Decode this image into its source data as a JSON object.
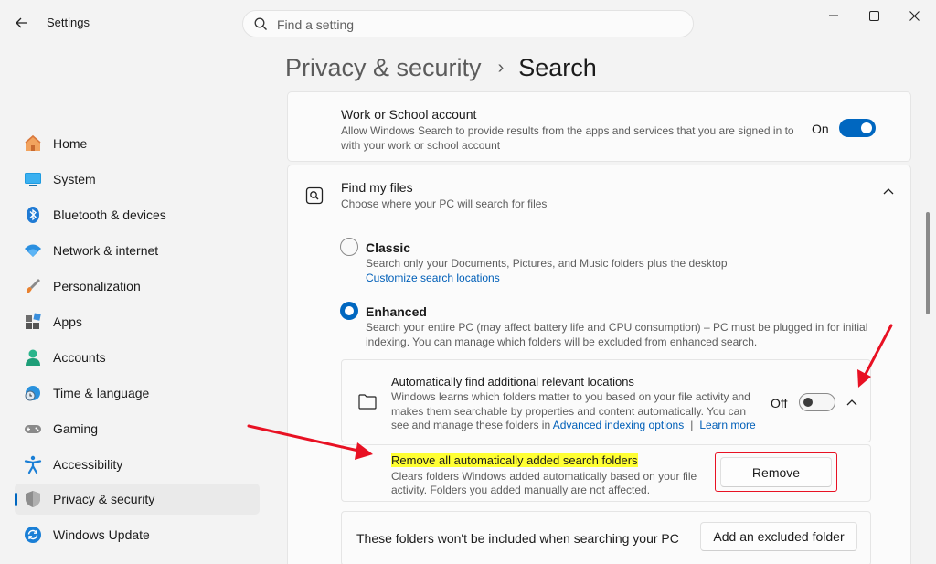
{
  "window": {
    "title": "Settings",
    "search_placeholder": "Find a setting"
  },
  "sidebar": {
    "items": [
      {
        "label": "Home",
        "icon": "home-icon"
      },
      {
        "label": "System",
        "icon": "system-icon"
      },
      {
        "label": "Bluetooth & devices",
        "icon": "bluetooth-icon"
      },
      {
        "label": "Network & internet",
        "icon": "wifi-icon"
      },
      {
        "label": "Personalization",
        "icon": "brush-icon"
      },
      {
        "label": "Apps",
        "icon": "apps-icon"
      },
      {
        "label": "Accounts",
        "icon": "accounts-icon"
      },
      {
        "label": "Time & language",
        "icon": "globe-clock-icon"
      },
      {
        "label": "Gaming",
        "icon": "gamepad-icon"
      },
      {
        "label": "Accessibility",
        "icon": "accessibility-icon"
      },
      {
        "label": "Privacy & security",
        "icon": "shield-icon",
        "selected": true
      },
      {
        "label": "Windows Update",
        "icon": "update-icon"
      }
    ]
  },
  "breadcrumb": {
    "parent": "Privacy & security",
    "separator": "›",
    "current": "Search"
  },
  "work_account": {
    "title": "Work or School account",
    "description_line1": "Allow Windows Search to provide results from the apps and services that you are signed in to",
    "description_line2": "with your work or school account",
    "toggle_label": "On",
    "toggle_on": true
  },
  "find_files": {
    "title": "Find my files",
    "description": "Choose where your PC will search for files",
    "expanded": true,
    "classic": {
      "label": "Classic",
      "description": "Search only your Documents, Pictures, and Music folders plus the desktop",
      "link": "Customize search locations",
      "selected": false
    },
    "enhanced": {
      "label": "Enhanced",
      "description_line1": "Search your entire PC (may affect battery life and CPU consumption) – PC must be plugged in for initial",
      "description_line2": "indexing. You can manage which folders will be excluded from enhanced search.",
      "selected": true
    }
  },
  "auto_locations": {
    "title": "Automatically find additional relevant locations",
    "description_line1": "Windows learns which folders matter to you based on your file activity and",
    "description_line2": "makes them searchable by properties and content automatically. You can",
    "description_line3_prefix": "see and manage these folders in ",
    "link_advanced": "Advanced indexing options",
    "link_separator": "|",
    "link_learn": "Learn more",
    "toggle_label": "Off",
    "toggle_on": false
  },
  "remove_folders": {
    "title": "Remove all automatically added search folders",
    "description_line1": "Clears folders Windows added automatically based on your file",
    "description_line2": "activity. Folders you added manually are not affected.",
    "button_label": "Remove"
  },
  "excluded": {
    "text": "These folders won't be included when searching your PC",
    "button_label": "Add an excluded folder"
  },
  "colors": {
    "accent": "#0067c0",
    "annotation_red": "#e81123",
    "highlight_yellow": "#ffff33",
    "link": "#005fb8"
  }
}
